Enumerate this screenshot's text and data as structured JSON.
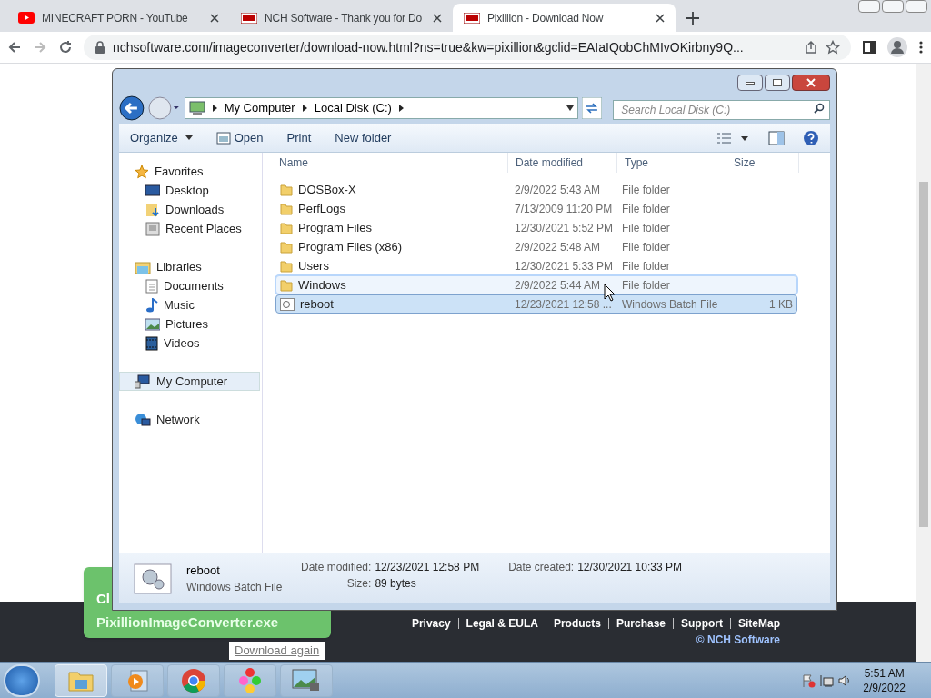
{
  "browser": {
    "tabs": [
      {
        "title": "MINECRAFT PORN - YouTube",
        "kind": "youtube",
        "selected": false
      },
      {
        "title": "NCH Software - Thank you for Do",
        "kind": "nch",
        "selected": false
      },
      {
        "title": "Pixillion - Download Now",
        "kind": "nch",
        "selected": true
      }
    ],
    "url": "nchsoftware.com/imageconverter/download-now.html?ns=true&kw=pixillion&gclid=EAIaIQobChMIvOKirbny9Q..."
  },
  "page": {
    "bubble_lines": [
      "Cl",
      "PixillionImageConverter.exe"
    ],
    "download_again": "Download again",
    "footer_links": [
      "Privacy",
      "Legal & EULA",
      "Products",
      "Purchase",
      "Support",
      "SiteMap"
    ],
    "copyright": "© NCH Software"
  },
  "explorer": {
    "breadcrumb": [
      "My Computer",
      "Local Disk (C:)"
    ],
    "search_placeholder": "Search Local Disk (C:)",
    "toolbar": [
      "Organize",
      "Open",
      "Print",
      "New folder"
    ],
    "nav": [
      {
        "label": "Favorites",
        "kind": "favorites",
        "selected": false,
        "children": [
          {
            "label": "Desktop",
            "kind": "desktop",
            "selected": false
          },
          {
            "label": "Downloads",
            "kind": "downloads",
            "selected": false
          },
          {
            "label": "Recent Places",
            "kind": "recent",
            "selected": false
          }
        ]
      },
      {
        "label": "Libraries",
        "kind": "libraries",
        "selected": false,
        "children": [
          {
            "label": "Documents",
            "kind": "documents",
            "selected": false
          },
          {
            "label": "Music",
            "kind": "music",
            "selected": false
          },
          {
            "label": "Pictures",
            "kind": "pictures",
            "selected": false
          },
          {
            "label": "Videos",
            "kind": "videos",
            "selected": false
          }
        ]
      },
      {
        "label": "My Computer",
        "kind": "computer",
        "selected": true
      },
      {
        "label": "Network",
        "kind": "network",
        "selected": false
      }
    ],
    "columns": [
      "Name",
      "Date modified",
      "Type",
      "Size"
    ],
    "rows": [
      {
        "name": "DOSBox-X",
        "date": "2/9/2022 5:43 AM",
        "type": "File folder",
        "kind": "folder",
        "selected": false,
        "hovered": false
      },
      {
        "name": "PerfLogs",
        "date": "7/13/2009 11:20 PM",
        "type": "File folder",
        "kind": "folder",
        "selected": false,
        "hovered": false
      },
      {
        "name": "Program Files",
        "date": "12/30/2021 5:52 PM",
        "type": "File folder",
        "kind": "folder",
        "selected": false,
        "hovered": false
      },
      {
        "name": "Program Files (x86)",
        "date": "2/9/2022 5:48 AM",
        "type": "File folder",
        "kind": "folder",
        "selected": false,
        "hovered": false
      },
      {
        "name": "Users",
        "date": "12/30/2021 5:33 PM",
        "type": "File folder",
        "kind": "folder",
        "selected": false,
        "hovered": false
      },
      {
        "name": "Windows",
        "date": "2/9/2022 5:44 AM",
        "type": "File folder",
        "kind": "folder",
        "selected": false,
        "hovered": true
      },
      {
        "name": "reboot",
        "date": "12/23/2021 12:58 ...",
        "type": "Windows Batch File",
        "size": "1 KB",
        "kind": "batch",
        "selected": true,
        "hovered": false
      }
    ],
    "details": {
      "name": "reboot",
      "type": "Windows Batch File",
      "fields": [
        {
          "label": "Date modified:",
          "value": "12/23/2021 12:58 PM"
        },
        {
          "label": "Size:",
          "value": "89 bytes"
        },
        {
          "label": "Date created:",
          "value": "12/30/2021 10:33 PM"
        }
      ]
    }
  },
  "taskbar": {
    "apps": [
      {
        "kind": "explorer",
        "selected": true
      },
      {
        "kind": "media",
        "selected": false
      },
      {
        "kind": "chrome",
        "selected": false
      },
      {
        "kind": "dosbox",
        "selected": false
      },
      {
        "kind": "image",
        "selected": false
      }
    ],
    "time": "5:51 AM",
    "date": "2/9/2022"
  }
}
